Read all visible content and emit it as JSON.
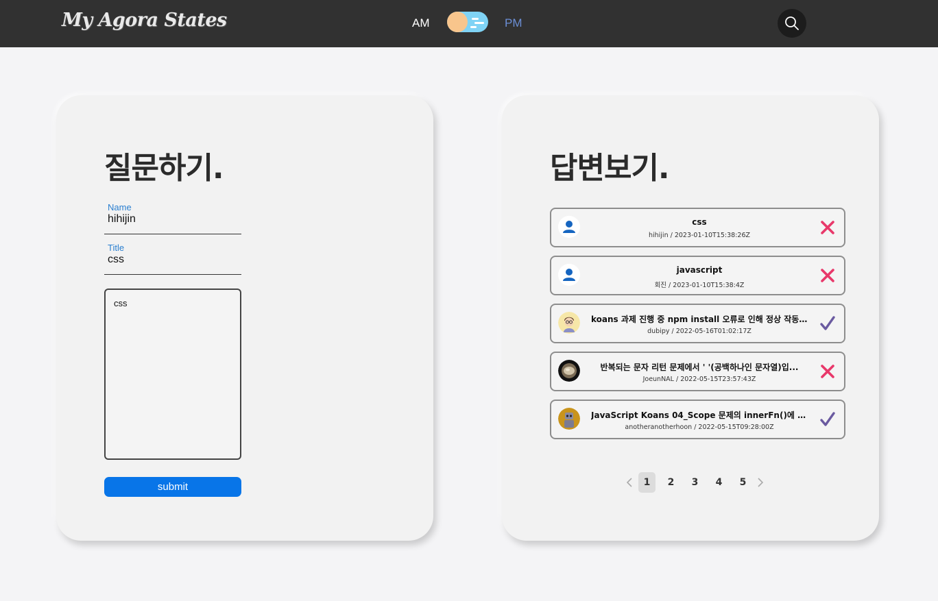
{
  "header": {
    "logo": "My Agora States",
    "am_label": "AM",
    "pm_label": "PM",
    "theme_toggle": "day"
  },
  "ask": {
    "title": "질문하기.",
    "name_label": "Name",
    "name_value": "hihijin",
    "title_label": "Title",
    "title_value": "css",
    "body_value": "css",
    "submit_label": "submit"
  },
  "answers": {
    "title": "답변보기.",
    "items": [
      {
        "title": "css",
        "meta": "hihijin / 2023-01-10T15:38:26Z",
        "avatar": "default-user-icon",
        "status": "unanswered"
      },
      {
        "title": "javascript",
        "meta": "회진 / 2023-01-10T15:38:4Z",
        "avatar": "default-user-icon",
        "status": "unanswered"
      },
      {
        "title": "koans 과제 진행 중 npm install 오류로 인해 정상 작동...",
        "meta": "dubipy / 2022-05-16T01:02:17Z",
        "avatar": "user-avatar",
        "status": "answered"
      },
      {
        "title": "반복되는 문자 리턴 문제에서 ' '(공백하나인 문자열)입...",
        "meta": "JoeunNAL / 2022-05-15T23:57:43Z",
        "avatar": "user-avatar",
        "status": "unanswered"
      },
      {
        "title": "JavaScript Koans 04_Scope 문제의 innerFn()에 대하...",
        "meta": "anotheranotherhoon / 2022-05-15T09:28:00Z",
        "avatar": "user-avatar",
        "status": "answered"
      }
    ],
    "pages": [
      "1",
      "2",
      "3",
      "4",
      "5"
    ],
    "current_page": "1"
  },
  "colors": {
    "header_bg": "#313131",
    "accent_blue": "#0875e8",
    "label_blue": "#2a7fd0",
    "unanswered_x": "#e8386a",
    "answered_check": "#6a5aa0"
  }
}
